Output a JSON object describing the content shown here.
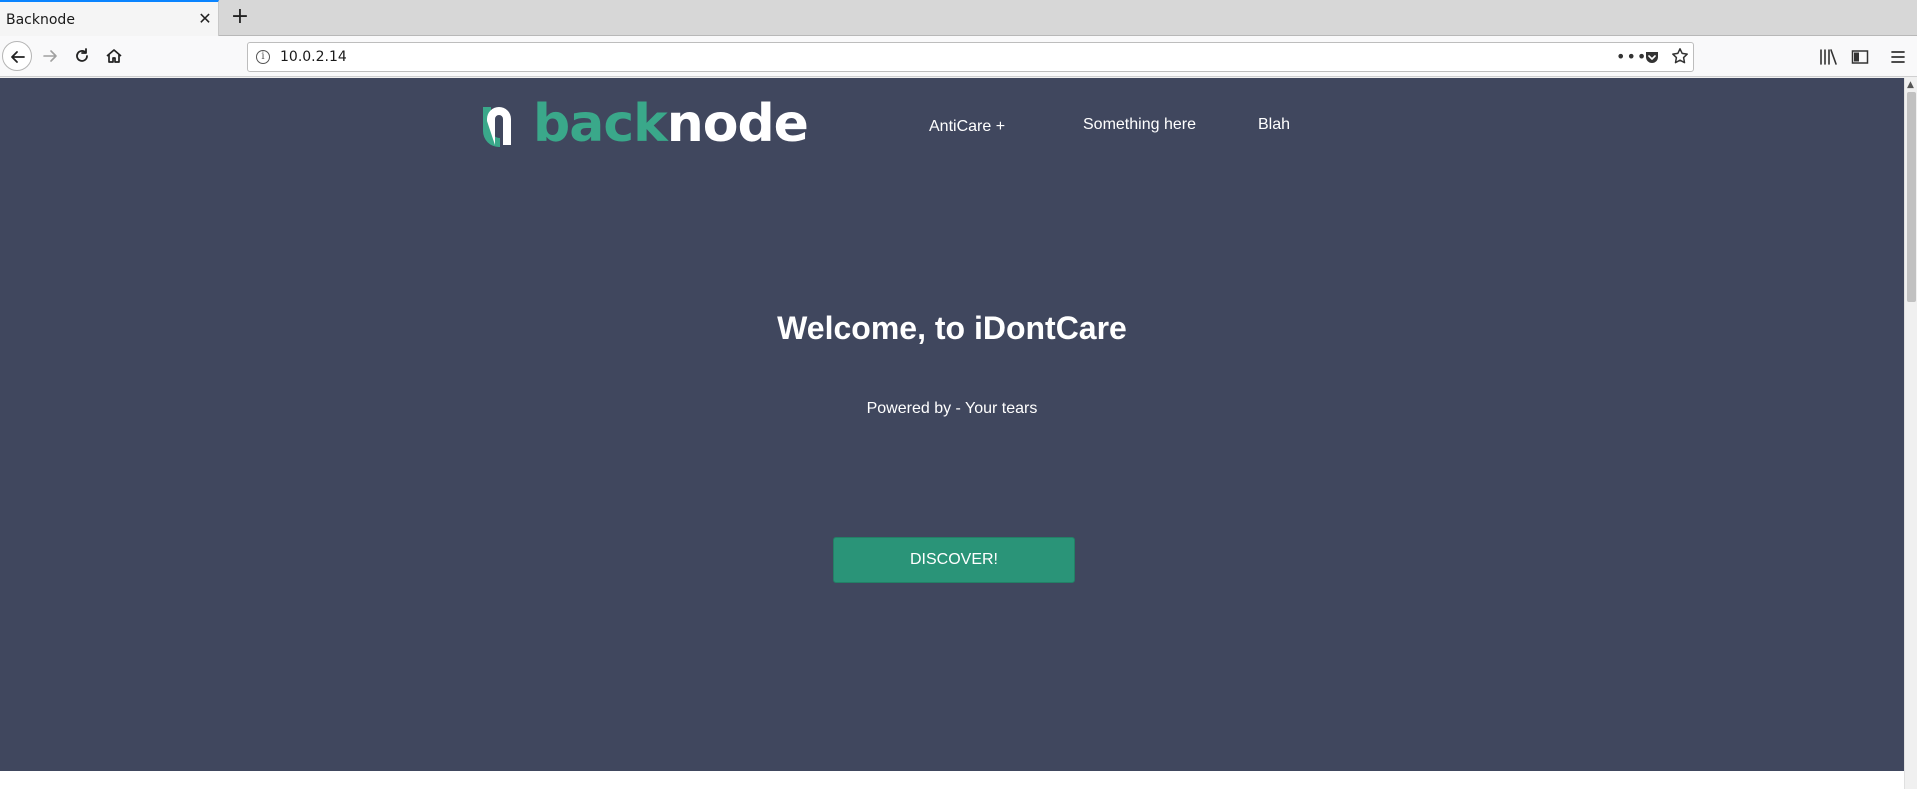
{
  "browser": {
    "tab_title": "Backnode",
    "tab_close_glyph": "✕",
    "new_tab_glyph": "+",
    "url": "10.0.2.14",
    "more_glyph": "•••"
  },
  "site": {
    "logo": {
      "part1": "back",
      "part2": "node",
      "colors": {
        "accent": "#3aa88a",
        "light": "#ffffff"
      }
    },
    "nav": [
      {
        "label": "AntiCare +"
      },
      {
        "label": "Something here"
      },
      {
        "label": "Blah"
      }
    ],
    "hero": {
      "headline": "Welcome, to iDontCare",
      "subline": "Powered by - Your tears",
      "cta_label": "DISCOVER!",
      "background": "#40475e",
      "cta_color": "#2a9478"
    }
  }
}
